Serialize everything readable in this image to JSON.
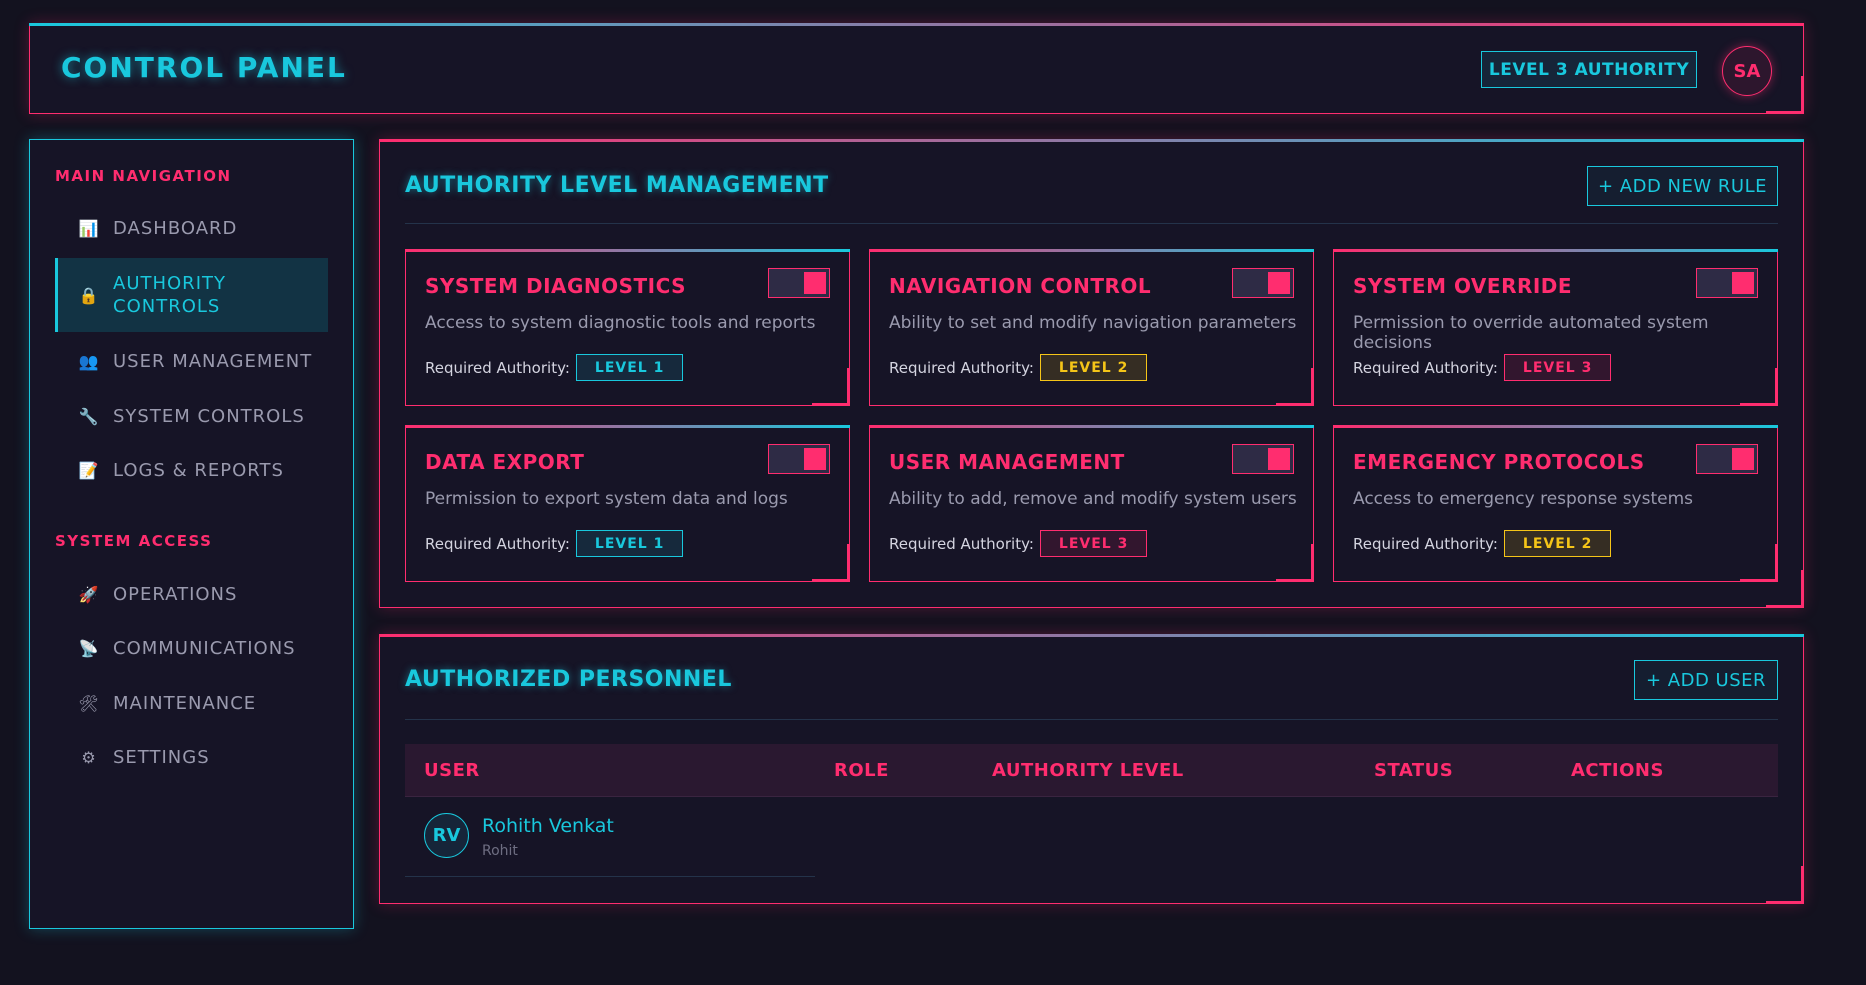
{
  "header": {
    "title": "CONTROL PANEL",
    "authority_badge": "LEVEL 3 AUTHORITY",
    "avatar_initials": "SA"
  },
  "sidebar": {
    "main_section": "MAIN NAVIGATION",
    "main_items": [
      {
        "icon": "chart-icon",
        "glyph": "📊",
        "label": "DASHBOARD"
      },
      {
        "icon": "lock-icon",
        "glyph": "🔒",
        "label": "AUTHORITY CONTROLS",
        "active": true
      },
      {
        "icon": "users-icon",
        "glyph": "👥",
        "label": "USER MANAGEMENT"
      },
      {
        "icon": "wrench-icon",
        "glyph": "🔧",
        "label": "SYSTEM CONTROLS"
      },
      {
        "icon": "memo-icon",
        "glyph": "📝",
        "label": "LOGS & REPORTS"
      }
    ],
    "access_section": "SYSTEM ACCESS",
    "access_items": [
      {
        "icon": "rocket-icon",
        "glyph": "🚀",
        "label": "OPERATIONS"
      },
      {
        "icon": "satellite-icon",
        "glyph": "📡",
        "label": "COMMUNICATIONS"
      },
      {
        "icon": "tools-icon",
        "glyph": "🛠",
        "label": "MAINTENANCE"
      },
      {
        "icon": "gear-icon",
        "glyph": "⚙",
        "label": "SETTINGS"
      }
    ]
  },
  "authority_panel": {
    "title": "AUTHORITY LEVEL MANAGEMENT",
    "add_button": "+ ADD NEW RULE",
    "required_label": "Required Authority:",
    "cards": [
      {
        "title": "SYSTEM DIAGNOSTICS",
        "desc": "Access to system diagnostic tools and reports",
        "level": "LEVEL 1",
        "level_class": "l1",
        "enabled": true
      },
      {
        "title": "NAVIGATION CONTROL",
        "desc": "Ability to set and modify navigation parameters",
        "level": "LEVEL 2",
        "level_class": "l2",
        "enabled": true
      },
      {
        "title": "SYSTEM OVERRIDE",
        "desc": "Permission to override automated system decisions",
        "level": "LEVEL 3",
        "level_class": "l3",
        "enabled": true
      },
      {
        "title": "DATA EXPORT",
        "desc": "Permission to export system data and logs",
        "level": "LEVEL 1",
        "level_class": "l1",
        "enabled": true
      },
      {
        "title": "USER MANAGEMENT",
        "desc": "Ability to add, remove and modify system users",
        "level": "LEVEL 3",
        "level_class": "l3",
        "enabled": true
      },
      {
        "title": "EMERGENCY PROTOCOLS",
        "desc": "Access to emergency response systems",
        "level": "LEVEL 2",
        "level_class": "l2",
        "enabled": true
      }
    ]
  },
  "personnel_panel": {
    "title": "AUTHORIZED PERSONNEL",
    "add_button": "+ ADD USER",
    "columns": [
      "USER",
      "ROLE",
      "AUTHORITY LEVEL",
      "STATUS",
      "ACTIONS"
    ],
    "rows": [
      {
        "initials": "RV",
        "name": "Rohith Venkat",
        "handle": "Rohit"
      }
    ]
  },
  "colors": {
    "accent_cyan": "#19c8dd",
    "accent_pink": "#ff2d6f",
    "level_2_yellow": "#f5c518",
    "background": "#13121f"
  }
}
